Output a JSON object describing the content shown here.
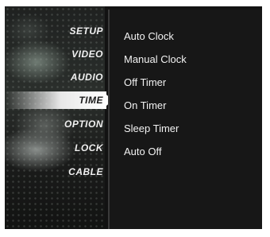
{
  "menu": {
    "categories": [
      {
        "label": "SETUP",
        "selected": false
      },
      {
        "label": "VIDEO",
        "selected": false
      },
      {
        "label": "AUDIO",
        "selected": false
      },
      {
        "label": "TIME",
        "selected": true
      },
      {
        "label": "OPTION",
        "selected": false
      },
      {
        "label": "LOCK",
        "selected": false
      },
      {
        "label": "CABLE",
        "selected": false
      }
    ],
    "items": [
      {
        "label": "Auto Clock"
      },
      {
        "label": "Manual Clock"
      },
      {
        "label": "Off Timer"
      },
      {
        "label": "On Timer"
      },
      {
        "label": "Sleep Timer"
      },
      {
        "label": "Auto Off"
      }
    ]
  }
}
